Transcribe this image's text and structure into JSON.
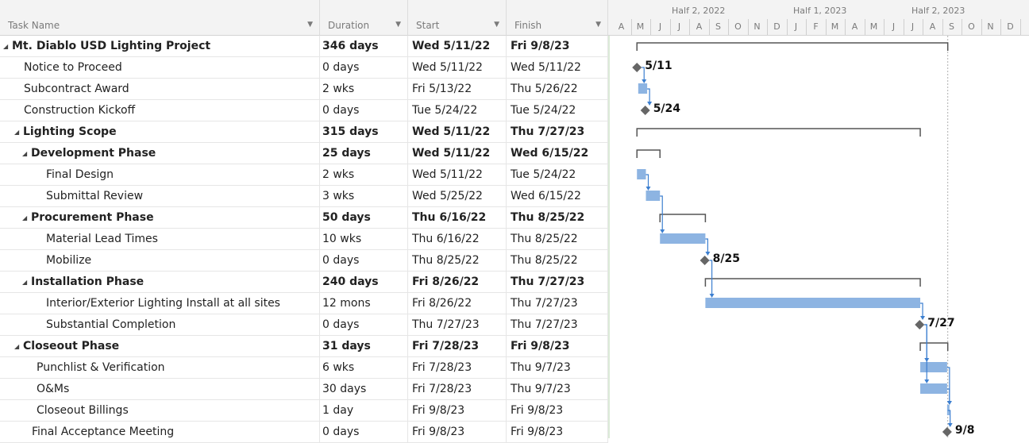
{
  "columns": {
    "task_name": "Task Name",
    "duration": "Duration",
    "start": "Start",
    "finish": "Finish"
  },
  "timescale": {
    "halves": [
      "Half 2, 2022",
      "Half 1, 2023",
      "Half 2, 2023"
    ],
    "months": [
      "A",
      "M",
      "J",
      "J",
      "A",
      "S",
      "O",
      "N",
      "D",
      "J",
      "F",
      "M",
      "A",
      "M",
      "J",
      "J",
      "A",
      "S",
      "O",
      "N",
      "D"
    ]
  },
  "tasks": [
    {
      "name": "Mt. Diablo USD Lighting Project",
      "duration": "346 days",
      "start": "Wed 5/11/22",
      "finish": "Fri 9/8/23",
      "level": 0,
      "summary": true
    },
    {
      "name": "Notice to Proceed",
      "duration": "0 days",
      "start": "Wed 5/11/22",
      "finish": "Wed 5/11/22",
      "level": 1,
      "summary": false
    },
    {
      "name": "Subcontract Award",
      "duration": "2 wks",
      "start": "Fri 5/13/22",
      "finish": "Thu 5/26/22",
      "level": 1,
      "summary": false
    },
    {
      "name": "Construction Kickoff",
      "duration": "0 days",
      "start": "Tue 5/24/22",
      "finish": "Tue 5/24/22",
      "level": 1,
      "summary": false
    },
    {
      "name": "Lighting Scope",
      "duration": "315 days",
      "start": "Wed 5/11/22",
      "finish": "Thu 7/27/23",
      "level": 1,
      "summary": true
    },
    {
      "name": "Development Phase",
      "duration": "25 days",
      "start": "Wed 5/11/22",
      "finish": "Wed 6/15/22",
      "level": 2,
      "summary": true
    },
    {
      "name": "Final Design",
      "duration": "2 wks",
      "start": "Wed 5/11/22",
      "finish": "Tue 5/24/22",
      "level": 3,
      "summary": false
    },
    {
      "name": "Submittal Review",
      "duration": "3 wks",
      "start": "Wed 5/25/22",
      "finish": "Wed 6/15/22",
      "level": 3,
      "summary": false
    },
    {
      "name": "Procurement Phase",
      "duration": "50 days",
      "start": "Thu 6/16/22",
      "finish": "Thu 8/25/22",
      "level": 2,
      "summary": true
    },
    {
      "name": "Material Lead Times",
      "duration": "10 wks",
      "start": "Thu 6/16/22",
      "finish": "Thu 8/25/22",
      "level": 3,
      "summary": false
    },
    {
      "name": "Mobilize",
      "duration": "0 days",
      "start": "Thu 8/25/22",
      "finish": "Thu 8/25/22",
      "level": 3,
      "summary": false
    },
    {
      "name": "Installation Phase",
      "duration": "240 days",
      "start": "Fri 8/26/22",
      "finish": "Thu 7/27/23",
      "level": 2,
      "summary": true
    },
    {
      "name": "Interior/Exterior Lighting Install at all sites",
      "duration": "12 mons",
      "start": "Fri 8/26/22",
      "finish": "Thu 7/27/23",
      "level": 3,
      "summary": false
    },
    {
      "name": "Substantial Completion",
      "duration": "0 days",
      "start": "Thu 7/27/23",
      "finish": "Thu 7/27/23",
      "level": 3,
      "summary": false
    },
    {
      "name": "Closeout Phase",
      "duration": "31 days",
      "start": "Fri 7/28/23",
      "finish": "Fri 9/8/23",
      "level": 1,
      "summary": true
    },
    {
      "name": "Punchlist & Verification",
      "duration": "6 wks",
      "start": "Fri 7/28/23",
      "finish": "Thu 9/7/23",
      "level": 2,
      "summary": false
    },
    {
      "name": "O&Ms",
      "duration": "30 days",
      "start": "Fri 7/28/23",
      "finish": "Thu 9/7/23",
      "level": 2,
      "summary": false
    },
    {
      "name": "Closeout Billings",
      "duration": "1 day",
      "start": "Fri 9/8/23",
      "finish": "Fri 9/8/23",
      "level": 2,
      "summary": false
    },
    {
      "name": "Final Acceptance Meeting",
      "duration": "0 days",
      "start": "Fri 9/8/23",
      "finish": "Fri 9/8/23",
      "level": 2,
      "summary": false
    }
  ],
  "milestone_labels": {
    "notice_to_proceed": "5/11",
    "construction_kickoff": "5/24",
    "mobilize": "8/25",
    "substantial_completion": "7/27",
    "final_acceptance": "9/8"
  },
  "colors": {
    "task_bar": "#8db4e2",
    "link": "#3c7fd0",
    "summary": "#555555",
    "milestone": "#666666",
    "header_bg": "#f3f3f3"
  },
  "icons": {
    "collapse": "collapse-triangle-icon",
    "dropdown": "dropdown-arrow-icon",
    "milestone": "milestone-diamond-icon"
  }
}
